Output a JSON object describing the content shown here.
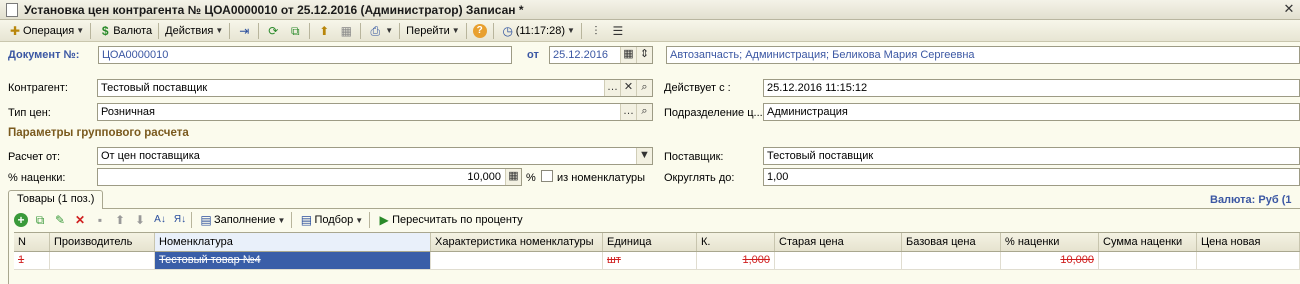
{
  "window": {
    "title": "Установка цен контрагента № ЦОА0000010 от 25.12.2016 (Администратор) Записан *"
  },
  "toolbar": {
    "operation": "Операция",
    "currency": "Валюта",
    "actions": "Действия",
    "goto": "Перейти",
    "time": "(11:17:28)"
  },
  "header": {
    "doc_label": "Документ №:",
    "doc_number": "ЦОА0000010",
    "date_label": "от",
    "date": "25.12.2016",
    "info": "Автозапчасть; Администрация; Беликова Мария Сергеевна"
  },
  "form": {
    "counterparty_label": "Контрагент:",
    "counterparty": "Тестовый поставщик",
    "valid_from_label": "Действует с :",
    "valid_from": "25.12.2016 11:15:12",
    "price_type_label": "Тип цен:",
    "price_type": "Розничная",
    "department_label": "Подразделение ц...",
    "department": "Администрация",
    "group_section": "Параметры группового расчета",
    "calc_from_label": "Расчет от:",
    "calc_from": "От цен поставщика",
    "supplier_label": "Поставщик:",
    "supplier": "Тестовый поставщик",
    "markup_label": "% наценки:",
    "markup": "10,000",
    "markup_unit": "%",
    "from_nomenclature": "из номенклатуры",
    "round_label": "Округлять до:",
    "round": "1,00"
  },
  "tabs": {
    "goods": "Товары (1 поз.)"
  },
  "currency_note": "Валюта: Руб (1",
  "grid_toolbar": {
    "fill": "Заполнение",
    "select": "Подбор",
    "recalc": "Пересчитать по проценту"
  },
  "table": {
    "columns": [
      "N",
      "Производитель",
      "Номенклатура",
      "Характеристика номенклатуры",
      "Единица",
      "К.",
      "Старая цена",
      "Базовая цена",
      "% наценки",
      "Сумма наценки",
      "Цена новая"
    ],
    "rows": [
      {
        "n": "1",
        "maker": "",
        "item": "Тестовый товар №4",
        "char": "",
        "unit": "шт",
        "k": "1,000",
        "old": "",
        "base": "",
        "markup": "10,000",
        "sum": "",
        "new": ""
      }
    ]
  }
}
